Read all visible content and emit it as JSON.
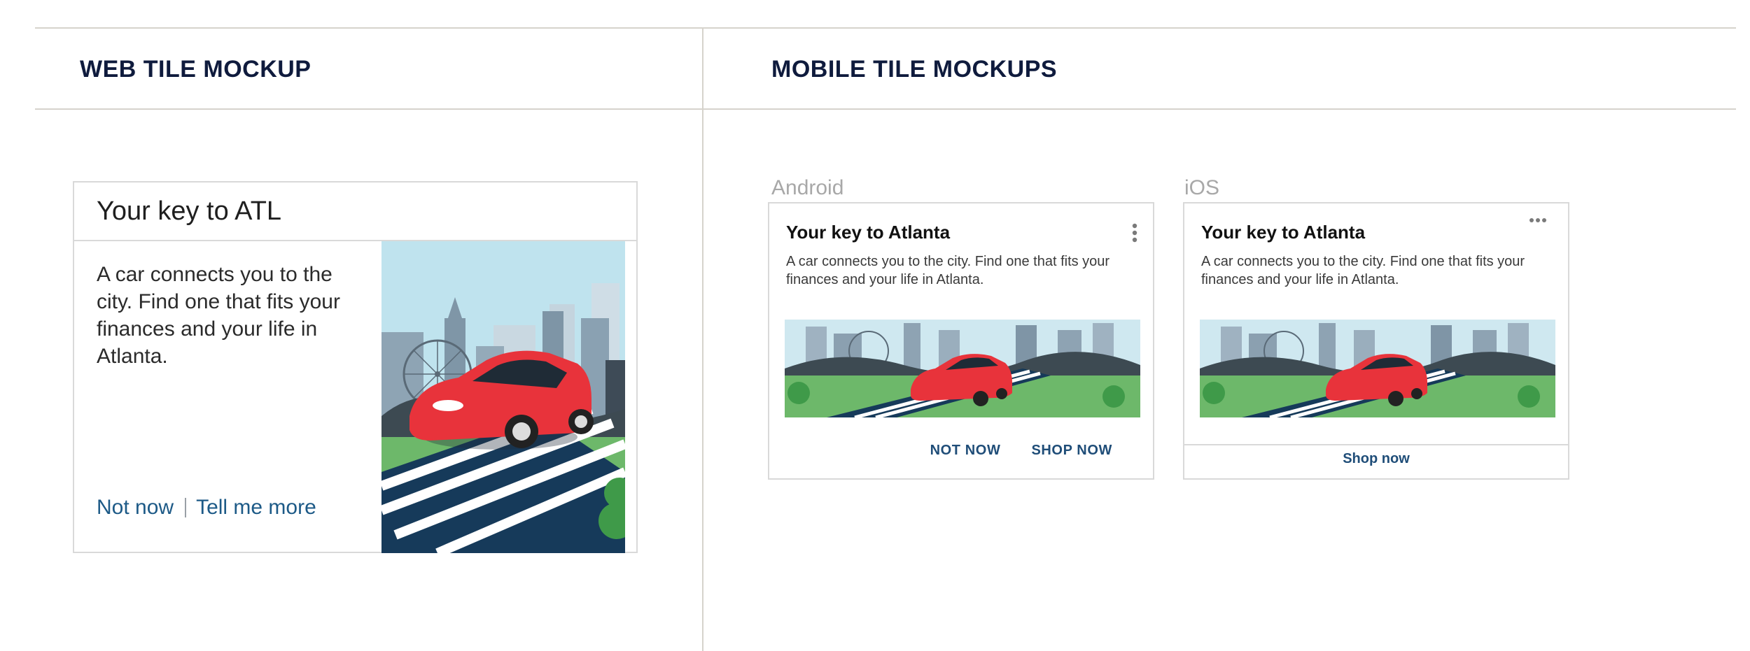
{
  "sections": {
    "web_title": "WEB TILE MOCKUP",
    "mobile_title": "MOBILE TILE MOCKUPS"
  },
  "web_tile": {
    "title": "Your key to ATL",
    "body": "A car connects you to the city. Find one that fits your finances and your life in Atlanta.",
    "not_now": "Not now",
    "tell_me_more": "Tell me more"
  },
  "android": {
    "platform": "Android",
    "title": "Your key to Atlanta",
    "body": "A car connects you to the city. Find one that fits your finances and your life in Atlanta.",
    "not_now": "NOT NOW",
    "shop_now": "SHOP NOW"
  },
  "ios": {
    "platform": "iOS",
    "title": "Your key to Atlanta",
    "body": "A car connects you to the city. Find one that fits your finances and your life in Atlanta.",
    "shop_now": "Shop now"
  },
  "colors": {
    "heading": "#0f1b3d",
    "link": "#1d5a87",
    "car": "#e8333b",
    "grass": "#6db86a",
    "sky": "#bfe3ee"
  },
  "icons": [
    "kebab-menu-icon",
    "more-dots-icon"
  ]
}
